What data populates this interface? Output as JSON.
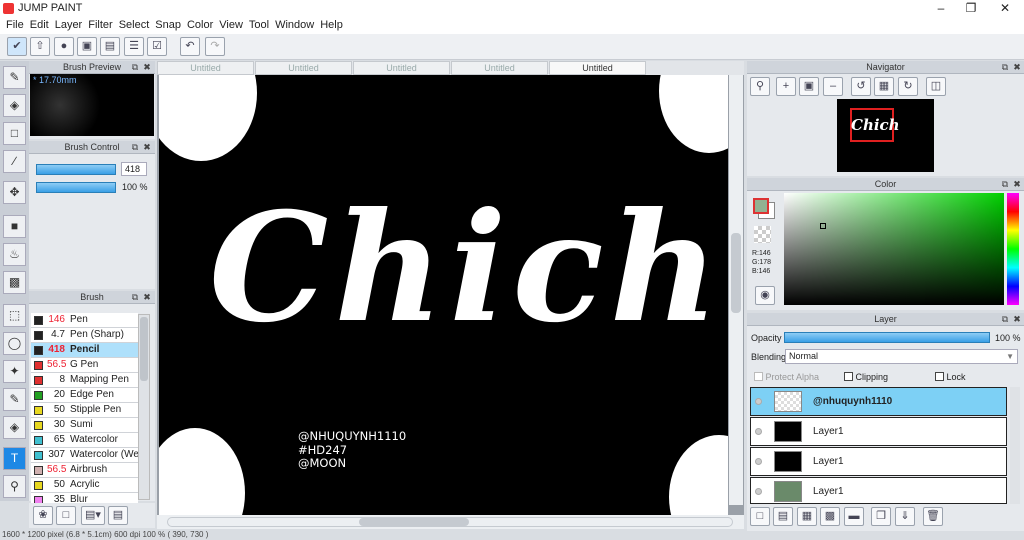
{
  "app": {
    "title": "JUMP PAINT"
  },
  "menu": [
    "File",
    "Edit",
    "Layer",
    "Filter",
    "Select",
    "Snap",
    "Color",
    "View",
    "Tool",
    "Window",
    "Help"
  ],
  "tabs": [
    "Untitled",
    "Untitled",
    "Untitled",
    "Untitled",
    "Untitled"
  ],
  "brush_preview": {
    "title": "Brush Preview",
    "size": "* 17.70mm"
  },
  "brush_control": {
    "title": "Brush Control",
    "size": "418",
    "opacity": "100 %"
  },
  "brush": {
    "title": "Brush",
    "items": [
      {
        "size": "146",
        "name": "Pen",
        "color": "#222222",
        "red": true
      },
      {
        "size": "4.7",
        "name": "Pen (Sharp)",
        "color": "#222222",
        "red": false
      },
      {
        "size": "418",
        "name": "Pencil",
        "color": "#222222",
        "red": true,
        "selected": true
      },
      {
        "size": "56.5",
        "name": "G Pen",
        "color": "#e03030",
        "red": true
      },
      {
        "size": "8",
        "name": "Mapping Pen",
        "color": "#e03030",
        "red": false
      },
      {
        "size": "20",
        "name": "Edge Pen",
        "color": "#22a022",
        "red": false
      },
      {
        "size": "50",
        "name": "Stipple Pen",
        "color": "#e8d820",
        "red": false
      },
      {
        "size": "30",
        "name": "Sumi",
        "color": "#e8d820",
        "red": false
      },
      {
        "size": "65",
        "name": "Watercolor",
        "color": "#40c0d0",
        "red": false
      },
      {
        "size": "307",
        "name": "Watercolor (Wet)",
        "color": "#40c0d0",
        "red": false
      },
      {
        "size": "56.5",
        "name": "Airbrush",
        "color": "#d0b0b0",
        "red": true
      },
      {
        "size": "50",
        "name": "Acrylic",
        "color": "#e8d820",
        "red": false
      },
      {
        "size": "35",
        "name": "Blur",
        "color": "#f080f0",
        "red": false
      }
    ]
  },
  "canvas": {
    "main_text": "Chich",
    "credits": [
      "@NHUQUYNH1110",
      "#HD247",
      "@MOON"
    ]
  },
  "navigator": {
    "title": "Navigator",
    "preview_text": "Chich"
  },
  "color": {
    "title": "Color",
    "r": "R:146",
    "g": "G:178",
    "b": "B:146",
    "fg": "#92b292"
  },
  "layer": {
    "title": "Layer",
    "opacity_label": "Opacity",
    "opacity": "100 %",
    "blending_label": "Blending",
    "blending": "Normal",
    "protect_alpha": "Protect Alpha",
    "clipping": "Clipping",
    "lock": "Lock",
    "layers": [
      {
        "name": "@nhuquynh1110",
        "selected": true
      },
      {
        "name": "Layer1"
      },
      {
        "name": "Layer1"
      },
      {
        "name": "Layer1"
      }
    ]
  },
  "status": "1600 * 1200 pixel   (6.8 * 5.1cm)   600 dpi   100 %   ( 390, 730 )"
}
